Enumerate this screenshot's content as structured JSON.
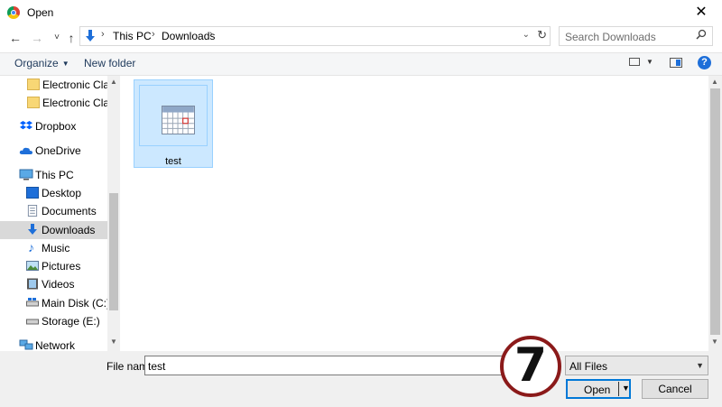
{
  "window": {
    "title": "Open",
    "close_glyph": "✕"
  },
  "nav": {
    "back_glyph": "←",
    "forward_glyph": "→",
    "recent_glyph": "˅",
    "up_glyph": "↑",
    "breadcrumb": [
      "This PC",
      "Downloads"
    ],
    "refresh_glyph": "↻",
    "search_placeholder": "Search Downloads"
  },
  "toolbar": {
    "organize_label": "Organize",
    "new_folder_label": "New folder",
    "help_label": "?"
  },
  "sidebar": {
    "items": [
      {
        "label": "Electronic Clarifi",
        "icon": "folder-icon"
      },
      {
        "label": "Electronic Clarifi",
        "icon": "folder-icon"
      },
      {
        "label": "Dropbox",
        "icon": "dropbox-icon"
      },
      {
        "label": "OneDrive",
        "icon": "onedrive-icon"
      },
      {
        "label": "This PC",
        "icon": "computer-icon"
      },
      {
        "label": "Desktop",
        "icon": "desktop-icon"
      },
      {
        "label": "Documents",
        "icon": "documents-icon"
      },
      {
        "label": "Downloads",
        "icon": "download-icon",
        "selected": true
      },
      {
        "label": "Music",
        "icon": "music-icon"
      },
      {
        "label": "Pictures",
        "icon": "pictures-icon"
      },
      {
        "label": "Videos",
        "icon": "videos-icon"
      },
      {
        "label": "Main Disk (C:)",
        "icon": "drive-icon"
      },
      {
        "label": "Storage (E:)",
        "icon": "drive-icon"
      },
      {
        "label": "Network",
        "icon": "network-icon"
      }
    ]
  },
  "files": [
    {
      "name": "test",
      "icon": "calendar-file-icon",
      "selected": true
    }
  ],
  "bottom": {
    "file_name_label": "File name:",
    "file_name_value": "test",
    "file_type_value": "All Files",
    "open_label": "Open",
    "cancel_label": "Cancel"
  },
  "annotation": {
    "step_number": "7"
  },
  "colors": {
    "accent": "#0078d7",
    "selection": "#cce8ff",
    "badge_ring": "#8b1a1a"
  }
}
